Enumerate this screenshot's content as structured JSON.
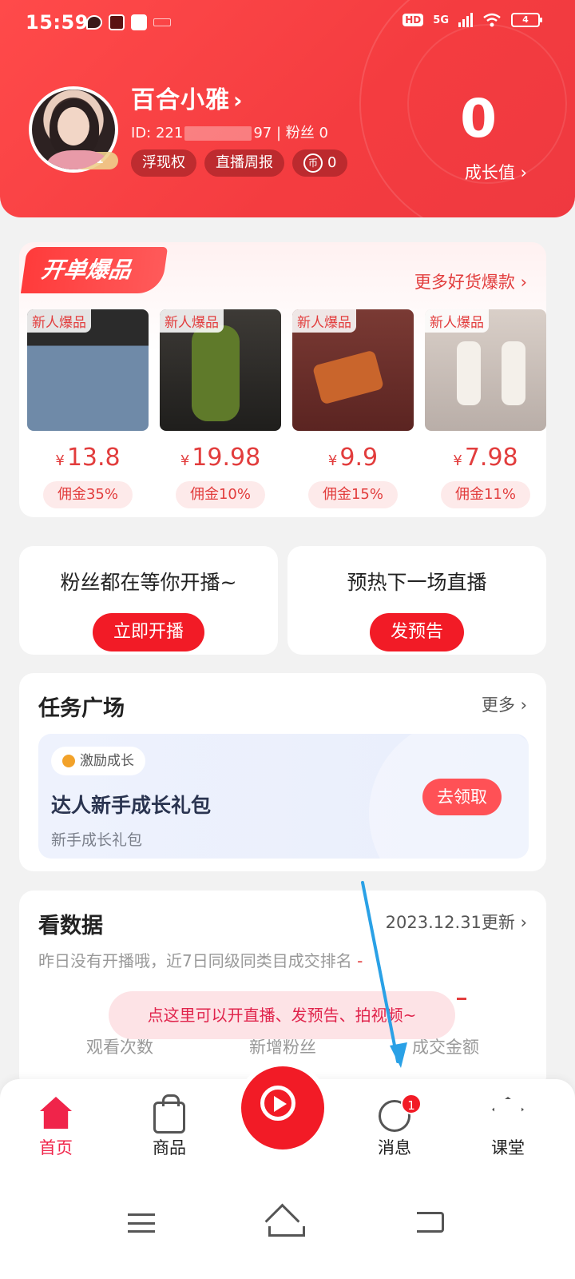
{
  "status_bar": {
    "time": "15:59",
    "network_label": "HD",
    "signal_label": "5G",
    "battery": "4"
  },
  "profile": {
    "name": "百合小雅",
    "id_prefix": "ID: 221",
    "id_suffix": "97 | 粉丝 0",
    "level": "V1",
    "tags": [
      "浮现权",
      "直播周报"
    ],
    "coin_value": "0",
    "coin_symbol": "币",
    "growth_value": "0",
    "growth_label": "成长值"
  },
  "hot_products": {
    "title": "开单爆品",
    "more_label": "更多好货爆款",
    "items": [
      {
        "badge": "新人爆品",
        "currency": "¥",
        "price": "13.8",
        "commission": "佣金35%"
      },
      {
        "badge": "新人爆品",
        "currency": "¥",
        "price": "19.98",
        "commission": "佣金10%"
      },
      {
        "badge": "新人爆品",
        "currency": "¥",
        "price": "9.9",
        "commission": "佣金15%"
      },
      {
        "badge": "新人爆品",
        "currency": "¥",
        "price": "7.98",
        "commission": "佣金11%"
      }
    ]
  },
  "live_tiles": [
    {
      "text": "粉丝都在等你开播~",
      "button": "立即开播"
    },
    {
      "text": "预热下一场直播",
      "button": "发预告"
    }
  ],
  "task_square": {
    "title": "任务广场",
    "more_label": "更多",
    "pill": "激励成长",
    "task_title": "达人新手成长礼包",
    "task_sub": "新手成长礼包",
    "claim_button": "去领取"
  },
  "data_card": {
    "title": "看数据",
    "update_label": "2023.12.31更新",
    "subtitle": "昨日没有开播哦，近7日同级同类目成交排名",
    "subtitle_value": "-",
    "metrics": [
      "观看次数",
      "新增粉丝",
      "成交金额"
    ]
  },
  "tooltip": "点这里可以开直播、发预告、拍视频~",
  "bottom_nav": {
    "items": [
      "首页",
      "商品",
      "消息",
      "课堂"
    ],
    "message_badge": "1"
  },
  "colors": {
    "brand_red": "#f21b26",
    "header_red": "#f43c40",
    "accent_pink": "#f0244a"
  }
}
